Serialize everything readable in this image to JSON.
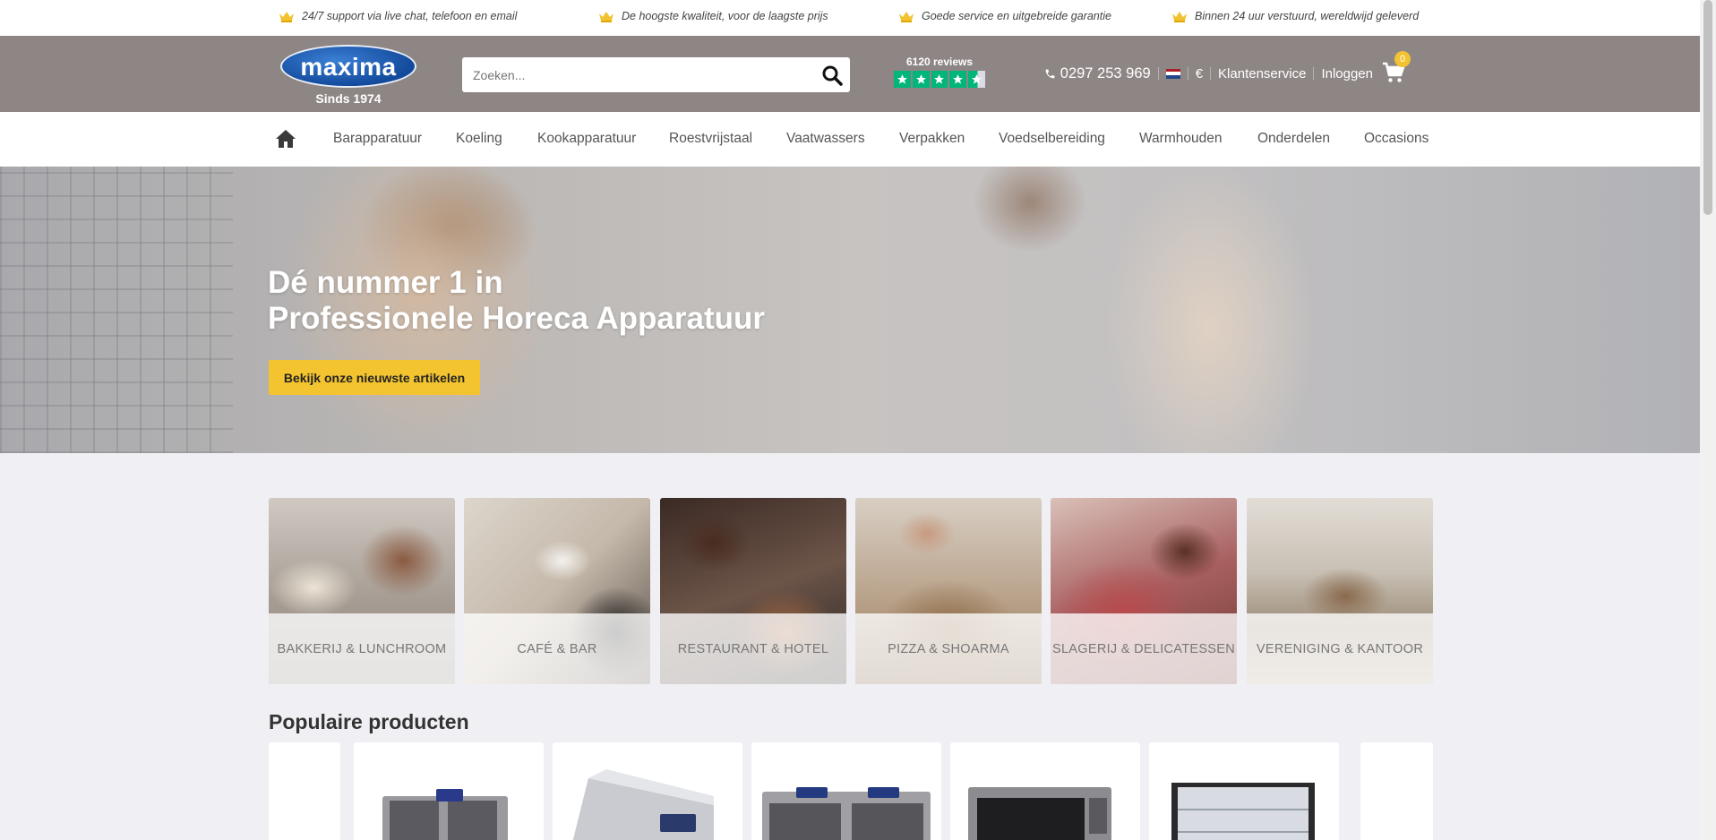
{
  "usp_bar": {
    "items": [
      "24/7 support via live chat, telefoon en email",
      "De hoogste kwaliteit, voor de laagste prijs",
      "Goede service en uitgebreide garantie",
      "Binnen 24 uur verstuurd, wereldwijd geleverd"
    ]
  },
  "header": {
    "logo_text": "maxima",
    "logo_since": "Sinds 1974",
    "search_placeholder": "Zoeken...",
    "reviews_count": "6120 reviews",
    "rating_stars": 4.5,
    "phone": "0297 253 969",
    "currency": "€",
    "customer_service": "Klantenservice",
    "login": "Inloggen",
    "cart_count": "0",
    "colors": {
      "header_bg": "#8e8685",
      "accent": "#f4c430",
      "trustpilot": "#00b67a"
    }
  },
  "nav": {
    "home_icon": "home-icon",
    "items": [
      "Barapparatuur",
      "Koeling",
      "Kookapparatuur",
      "Roestvrijstaal",
      "Vaatwassers",
      "Verpakken",
      "Voedselbereiding",
      "Warmhouden",
      "Onderdelen",
      "Occasions"
    ]
  },
  "hero": {
    "title_line1": "Dé nummer 1 in",
    "title_line2": "Professionele Horeca Apparatuur",
    "cta": "Bekijk onze nieuwste artikelen"
  },
  "categories": [
    "BAKKERIJ & LUNCHROOM",
    "CAFÉ & BAR",
    "RESTAURANT & HOTEL",
    "PIZZA & SHOARMA",
    "SLAGERIJ & DELICATESSEN",
    "VERENIGING & KANTOOR"
  ],
  "popular": {
    "title": "Populaire producten"
  }
}
